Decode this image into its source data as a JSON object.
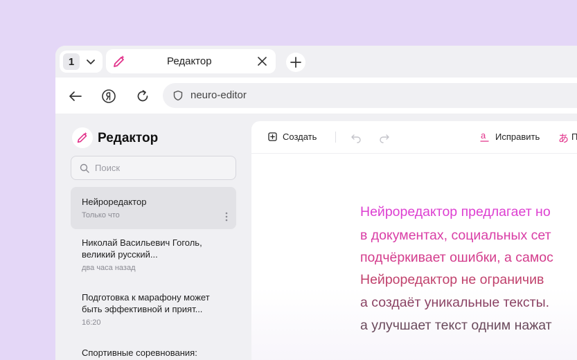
{
  "colors": {
    "background": "#e4d7f7",
    "accent": "#e2338b",
    "text_gradient": [
      "#dd3fd1",
      "#d33c8c",
      "#c0416c",
      "#8b4364",
      "#6b4a5c"
    ]
  },
  "tabstrip": {
    "tab_count": "1",
    "active_tab": {
      "title": "Редактор",
      "icon": "magic-pen-icon"
    }
  },
  "navbar": {
    "url": "neuro-editor"
  },
  "sidebar": {
    "app_title": "Редактор",
    "search_placeholder": "Поиск",
    "documents": [
      {
        "title": "Нейроредактор",
        "time": "Только что",
        "active": true
      },
      {
        "title": "Николай Васильевич Гоголь, великий русский...",
        "time": "два часа назад",
        "active": false
      },
      {
        "title": "Подготовка к марафону может быть эффективной и прият...",
        "time": "16:20",
        "active": false
      },
      {
        "title": "Спортивные соревнования:",
        "time": "",
        "active": false
      }
    ]
  },
  "toolbar": {
    "create_label": "Создать",
    "fix_label": "Исправить",
    "next_label": "П"
  },
  "editor": {
    "lines": [
      "Нейроредактор предлагает но",
      "в документах, социальных сет",
      "подчёркивает ошибки, а самос",
      "Нейроредактор не ограничив",
      "а создаёт уникальные тексты.",
      "а улучшает текст одним нажат"
    ]
  }
}
